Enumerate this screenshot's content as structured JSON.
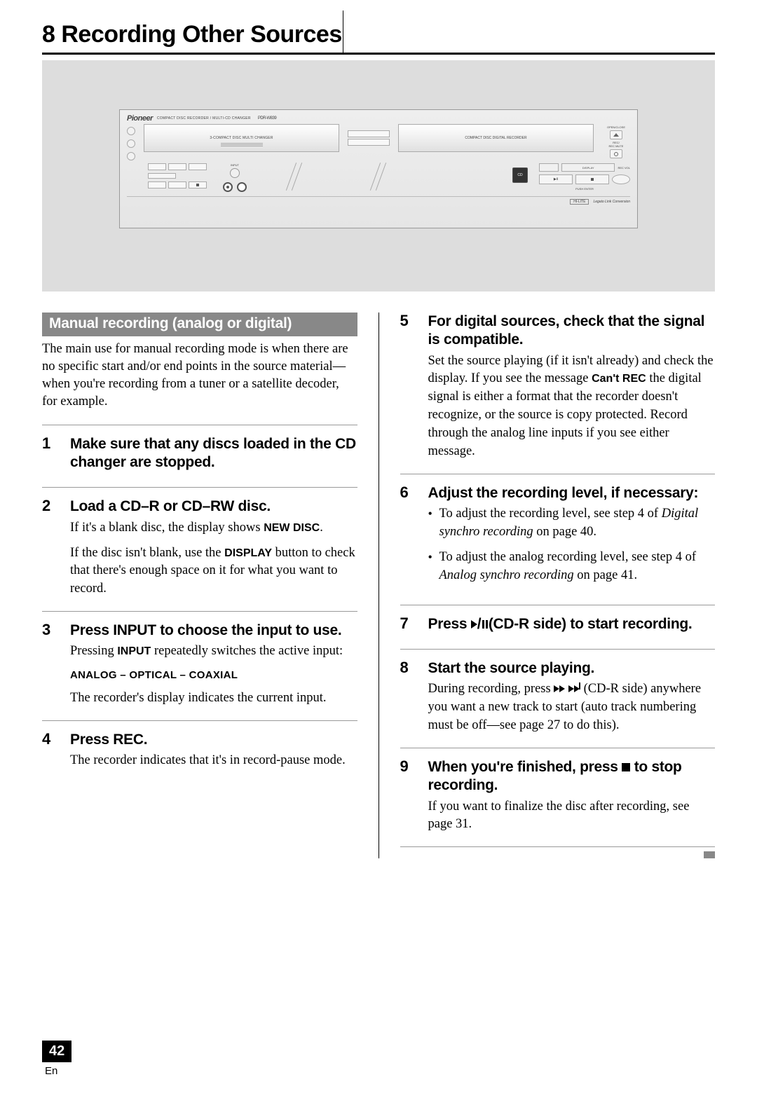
{
  "chapter": {
    "number": "8",
    "title": "Recording Other Sources"
  },
  "device": {
    "brand": "Pioneer",
    "subtitle": "COMPACT DISC RECORDER / MULTI-CD CHANGER",
    "model": "PDR-W839",
    "tray_left": "3-COMPACT DISC MULTI CHANGER",
    "tray_right": "COMPACT DISC DIGITAL RECORDER",
    "open_close": "OPEN/CLOSE",
    "rec_mute": "REC/\nREC MUTE",
    "rec_vol": "REC VOL",
    "input": "INPUT",
    "display_btn": "DISPLAY",
    "push_enter": "PUSH ENTER",
    "hires": "HI-LITE",
    "legato": "Legato Link Conversion"
  },
  "section_banner": "Manual recording (analog or digital)",
  "intro": "The main use for manual recording mode is when there are no specific start and/or end points in the source material—when you're recording from a tuner or a satellite decoder, for example.",
  "steps_left": [
    {
      "n": "1",
      "head": "Make sure that any discs loaded in the CD changer are stopped."
    },
    {
      "n": "2",
      "head": "Load a CD–R or CD–RW disc.",
      "body_html": "l2"
    },
    {
      "n": "3",
      "head": "Press INPUT to choose the input to use.",
      "body_html": "l3"
    },
    {
      "n": "4",
      "head": "Press REC.",
      "body_html": "l4"
    }
  ],
  "steps_right": [
    {
      "n": "5",
      "head": "For digital sources, check that the signal is compatible.",
      "body_html": "r5"
    },
    {
      "n": "6",
      "head": "Adjust the recording level, if necessary:",
      "body_html": "r6"
    },
    {
      "n": "7",
      "head_html": "r7h"
    },
    {
      "n": "8",
      "head": "Start the source playing.",
      "body_html": "r8"
    },
    {
      "n": "9",
      "head_html": "r9h",
      "body_html": "r9"
    }
  ],
  "text": {
    "l2_a": "If it's a blank disc, the display shows ",
    "l2_new_disc": "NEW DISC",
    "l2_b": ".",
    "l2_c": "If the disc isn't blank, use the ",
    "l2_display": "DISPLAY",
    "l2_d": " button to check that there's enough space on it for what you want to record.",
    "l3_a": "Pressing ",
    "l3_input": "INPUT",
    "l3_b": " repeatedly switches the active input:",
    "l3_chain": "ANALOG – OPTICAL – COAXIAL",
    "l3_c": "The recorder's display indicates the current input.",
    "l4": "The recorder indicates that it's in record-pause mode.",
    "r5_a": "Set the source playing (if it isn't already) and check the display. If you see the message ",
    "r5_cantrec": "Can't REC",
    "r5_b": " the digital signal is either a format that the recorder doesn't recognize, or the source is copy protected. Record through the analog line inputs if you see either message.",
    "r6_li1_a": "To adjust the recording level, see step 4 of ",
    "r6_li1_i": "Digital synchro recording",
    "r6_li1_b": " on page 40.",
    "r6_li2_a": "To adjust the analog recording level, see step 4 of ",
    "r6_li2_i": "Analog synchro recording",
    "r6_li2_b": " on page 41.",
    "r7h_a": "Press ",
    "r7h_b": " (CD-R side) to start recording.",
    "r8_a": "During recording, press ",
    "r8_b": " (CD-R side) anywhere you want a new track to start (auto track numbering must be off—see page 27 to do this).",
    "r9h_a": "When you're finished, press ",
    "r9h_b": " to stop recording.",
    "r9": "If you want to finalize the disc after recording, see page 31."
  },
  "page_number": "42",
  "lang": "En"
}
